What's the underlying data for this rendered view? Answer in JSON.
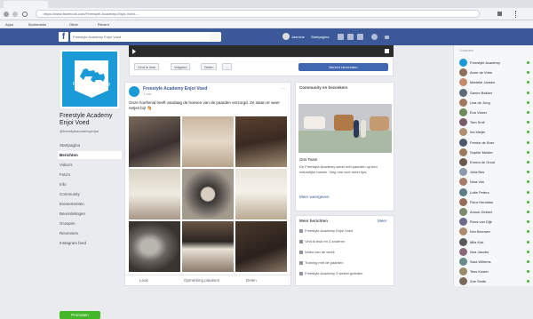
{
  "browser": {
    "url": "https://www.facebook.com/Freestyle-Academy-Enjoi-Voed-...",
    "bookmarks": [
      "Apps",
      "Bookmarks",
      "Other",
      "Recent"
    ]
  },
  "fb": {
    "logo": "f",
    "search_placeholder": "Freestyle Academy Enjoi Voed",
    "user_name": "Jasmine",
    "home": "Startpagina"
  },
  "page": {
    "banner_text": "Freestyle Academy",
    "name": "Freestyle Academy Enjoi Voed",
    "handle": "@freestyleacademyenjoi",
    "nav": [
      "Startpagina",
      "Berichten",
      "Video's",
      "Foto's",
      "Info",
      "Community",
      "Evenementen",
      "Beoordelingen",
      "Groepen",
      "Recensies",
      "Instagram feed"
    ],
    "active_nav": 1,
    "promote": "Promoten"
  },
  "actions": {
    "liked": "Vind ik leuk",
    "following": "Volgend",
    "share": "Delen",
    "more": "...",
    "send_message": "Bericht verzenden"
  },
  "post": {
    "author": "Freestyle Academy Enjoi Voed",
    "time": "1 uur",
    "more": "...",
    "text": "Onze hoefsmid heeft vandaag de hoeven van de paarden verzorgd. Ze staan er weer netjes bij! 🐴",
    "footer": [
      "Leuk",
      "Opmerking plaatsen",
      "Delen"
    ]
  },
  "sidebar": {
    "card1_title": "Community en bezoekers",
    "card1_subtitle": "Ons Team",
    "card1_body": "De Freestyle Academy werkt met paarden op een natuurlijke manier. Volg ons voor meer tips.",
    "card1_link": "Meer weergeven",
    "card2_title": "Meer berichten",
    "card2_link": "Meer",
    "recent": [
      "Freestyle Academy Enjoi Voed",
      "Vind ik leuk en 3 anderen",
      "Video van de week",
      "Training met de paarden",
      "Freestyle Academy 3 weken geleden"
    ]
  },
  "chat": {
    "header": "Contacten",
    "contacts": [
      "Freestyle Academy",
      "Anne de Vries",
      "Marieke Jansen",
      "Sanne Bakker",
      "Lisa de Jong",
      "Eva Visser",
      "Tom Smit",
      "Iris Meijer",
      "Femke de Boer",
      "Sophie Mulder",
      "Emma de Groot",
      "Julia Bos",
      "Nina Vos",
      "Lotte Peters",
      "Fleur Hendriks",
      "Anouk Dekker",
      "Roos van Dijk",
      "Kim Brouwer",
      "Mila Kok",
      "Noa Jacobs",
      "Sara Willems",
      "Tess Koster",
      "Zoe Smits"
    ]
  }
}
